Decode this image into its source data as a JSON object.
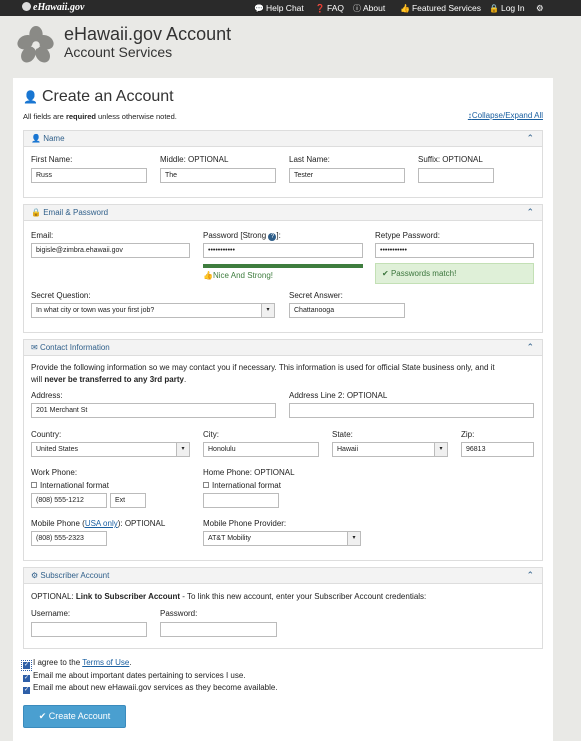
{
  "nav": {
    "brand": "eHawaii.gov",
    "help": "Help Chat",
    "faq": "FAQ",
    "about": "About",
    "featured": "Featured Services",
    "login": "Log In"
  },
  "header": {
    "title": "eHawaii.gov Account",
    "subtitle": "Account Services"
  },
  "page": {
    "title": "Create an Account",
    "req_pre": "All fields are ",
    "req_bold": "required",
    "req_post": " unless otherwise noted.",
    "collapse": "Collapse/Expand All"
  },
  "name": {
    "heading": "Name",
    "first_label": "First Name:",
    "first": "Russ",
    "middle_label": "Middle: OPTIONAL",
    "middle": "The",
    "last_label": "Last Name:",
    "last": "Tester",
    "suffix_label": "Suffix: OPTIONAL",
    "suffix": ""
  },
  "emailpw": {
    "heading": "Email & Password",
    "email_label": "Email:",
    "email": "bigisle@zimbra.ehawaii.gov",
    "pw_label": "Password [Strong ",
    "pw_label_end": "]:",
    "pw": "•••••••••••",
    "strength_text": "Nice And Strong!",
    "strength_percent": 100,
    "retype_label": "Retype Password:",
    "retype": "•••••••••••",
    "match_text": "Passwords match!",
    "question_label": "Secret Question:",
    "question": "In what city or town was your first job?",
    "answer_label": "Secret Answer:",
    "answer": "Chattanooga"
  },
  "contact": {
    "heading": "Contact Information",
    "intro": "Provide the following information so we may contact you if necessary. This information is used for official State business only, and it",
    "intro2_pre": "will ",
    "intro2_bold": "never be transferred to any 3rd party",
    "intro2_post": ".",
    "addr_label": "Address:",
    "addr": "201 Merchant St",
    "addr2_label": "Address Line 2: OPTIONAL",
    "addr2": "",
    "country_label": "Country:",
    "country": "United States",
    "city_label": "City:",
    "city": "Honolulu",
    "state_label": "State:",
    "state": "Hawaii",
    "zip_label": "Zip:",
    "zip": "96813",
    "work_label": "Work Phone:",
    "intl": "International format",
    "work": "(808) 555-1212",
    "ext": "Ext",
    "home_label": "Home Phone: OPTIONAL",
    "home": "",
    "mobile_label_pre": "Mobile Phone (",
    "mobile_label_link": "USA only",
    "mobile_label_post": "): OPTIONAL",
    "mobile": "(808) 555-2323",
    "provider_label": "Mobile Phone Provider:",
    "provider": "AT&T Mobility"
  },
  "subscriber": {
    "heading": "Subscriber Account",
    "intro_pre": "OPTIONAL: ",
    "intro_bold": "Link to Subscriber Account",
    "intro_post": " - To link this new account, enter your Subscriber Account credentials:",
    "user_label": "Username:",
    "user": "",
    "pass_label": "Password:",
    "pass": ""
  },
  "agree": {
    "terms_pre": "I agree to the ",
    "terms_link": "Terms of Use",
    "terms_post": ".",
    "email_updates": "Email me about important dates pertaining to services I use.",
    "email_new": "Email me about new eHawaii.gov services as they become available."
  },
  "submit": "Create Account"
}
